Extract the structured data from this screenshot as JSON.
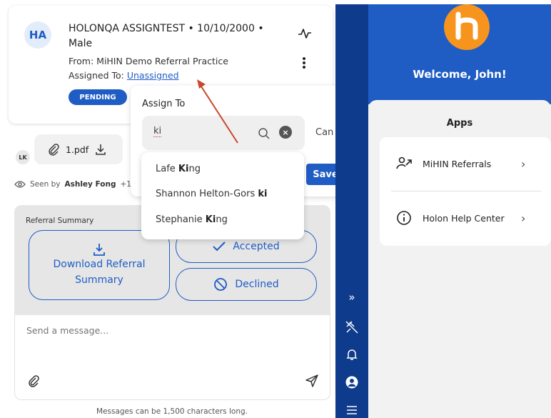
{
  "patient": {
    "initials": "HA",
    "name_line": "HOLONQA ASSIGNTEST • 10/10/2000 • Male",
    "from": "From: MiHIN Demo Referral Practice",
    "assigned_prefix": "Assigned To: ",
    "assigned_link": "Unassigned",
    "status": "PENDING"
  },
  "message": {
    "sender_initials": "LK",
    "attachment_name": "1.pdf",
    "seen_prefix": "Seen by",
    "seen_name": "Ashley Fong",
    "seen_suffix": "+1"
  },
  "summary": {
    "title": "Referral Summary",
    "download_label": "Download Referral Summary",
    "accepted_label": "Accepted",
    "declined_label": "Declined"
  },
  "composer": {
    "placeholder": "Send a message...",
    "limit_note": "Messages can be 1,500 characters long."
  },
  "assign_popover": {
    "title": "Assign To",
    "search_value": "ki",
    "cancel_label": "Can",
    "save_label": "Save",
    "results": [
      {
        "pre": "Lafe ",
        "match": "Ki",
        "post": "ng"
      },
      {
        "pre": "Shannon Helton-Gors ",
        "match": "ki",
        "post": ""
      },
      {
        "pre": "Stephanie ",
        "match": "Ki",
        "post": "ng"
      }
    ]
  },
  "right_panel": {
    "welcome": "Welcome, John!",
    "apps_title": "Apps",
    "apps": [
      {
        "label": "MiHIN Referrals",
        "icon": "user-arrow-icon"
      },
      {
        "label": "Holon Help Center",
        "icon": "info-icon"
      }
    ]
  },
  "colors": {
    "accent": "#1f5cc4",
    "nav_strip": "#0f3b8c",
    "logo": "#f7941d",
    "annotation_arrow": "#c9472b"
  }
}
